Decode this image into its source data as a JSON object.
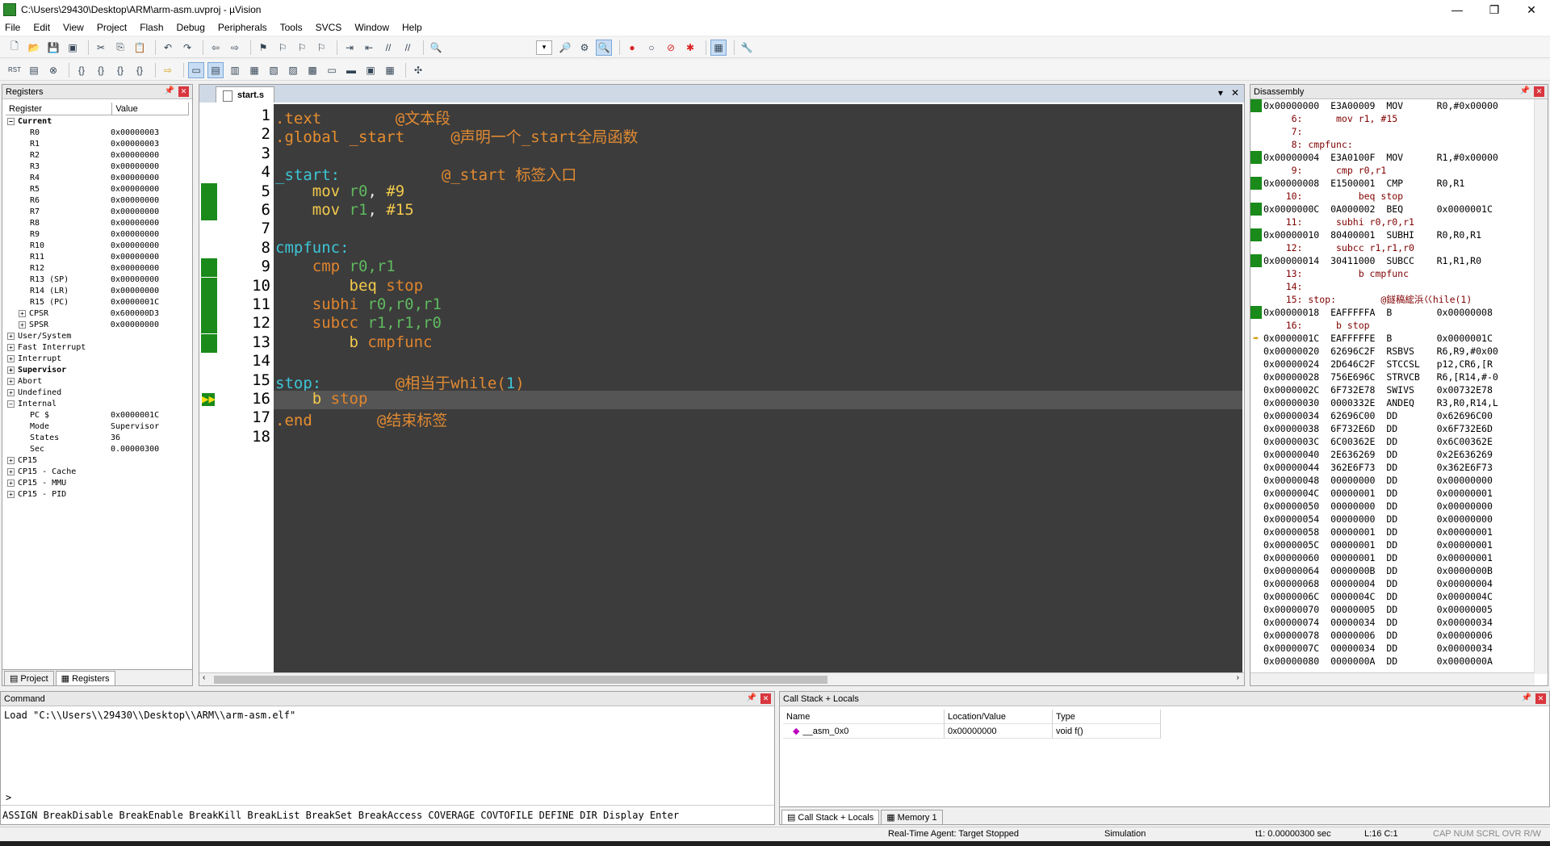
{
  "window": {
    "title": "C:\\Users\\29430\\Desktop\\ARM\\arm-asm.uvproj - µVision",
    "controls": [
      "—",
      "❐",
      "✕"
    ]
  },
  "menu": [
    "File",
    "Edit",
    "View",
    "Project",
    "Flash",
    "Debug",
    "Peripherals",
    "Tools",
    "SVCS",
    "Window",
    "Help"
  ],
  "registers": {
    "title": "Registers",
    "col_register": "Register",
    "col_value": "Value",
    "rows": [
      {
        "name": "Current",
        "value": "",
        "bold": true,
        "level": 0,
        "exp": "−"
      },
      {
        "name": "R0",
        "value": "0x00000003",
        "level": 2
      },
      {
        "name": "R1",
        "value": "0x00000003",
        "level": 2
      },
      {
        "name": "R2",
        "value": "0x00000000",
        "level": 2
      },
      {
        "name": "R3",
        "value": "0x00000000",
        "level": 2
      },
      {
        "name": "R4",
        "value": "0x00000000",
        "level": 2
      },
      {
        "name": "R5",
        "value": "0x00000000",
        "level": 2
      },
      {
        "name": "R6",
        "value": "0x00000000",
        "level": 2
      },
      {
        "name": "R7",
        "value": "0x00000000",
        "level": 2
      },
      {
        "name": "R8",
        "value": "0x00000000",
        "level": 2
      },
      {
        "name": "R9",
        "value": "0x00000000",
        "level": 2
      },
      {
        "name": "R10",
        "value": "0x00000000",
        "level": 2
      },
      {
        "name": "R11",
        "value": "0x00000000",
        "level": 2
      },
      {
        "name": "R12",
        "value": "0x00000000",
        "level": 2
      },
      {
        "name": "R13 (SP)",
        "value": "0x00000000",
        "level": 2
      },
      {
        "name": "R14 (LR)",
        "value": "0x00000000",
        "level": 2
      },
      {
        "name": "R15 (PC)",
        "value": "0x0000001C",
        "level": 2
      },
      {
        "name": "CPSR",
        "value": "0x600000D3",
        "level": 1,
        "exp": "+"
      },
      {
        "name": "SPSR",
        "value": "0x00000000",
        "level": 1,
        "exp": "+"
      },
      {
        "name": "User/System",
        "value": "",
        "level": 0,
        "exp": "+"
      },
      {
        "name": "Fast Interrupt",
        "value": "",
        "level": 0,
        "exp": "+"
      },
      {
        "name": "Interrupt",
        "value": "",
        "level": 0,
        "exp": "+"
      },
      {
        "name": "Supervisor",
        "value": "",
        "bold": true,
        "level": 0,
        "exp": "+"
      },
      {
        "name": "Abort",
        "value": "",
        "level": 0,
        "exp": "+"
      },
      {
        "name": "Undefined",
        "value": "",
        "level": 0,
        "exp": "+"
      },
      {
        "name": "Internal",
        "value": "",
        "level": 0,
        "exp": "−"
      },
      {
        "name": "PC  $",
        "value": "0x0000001C",
        "level": 2
      },
      {
        "name": "Mode",
        "value": "Supervisor",
        "level": 2
      },
      {
        "name": "States",
        "value": "36",
        "level": 2
      },
      {
        "name": "Sec",
        "value": "0.00000300",
        "level": 2
      },
      {
        "name": "CP15",
        "value": "",
        "level": 0,
        "exp": "+"
      },
      {
        "name": "CP15 - Cache",
        "value": "",
        "level": 0,
        "exp": "+"
      },
      {
        "name": "CP15 - MMU",
        "value": "",
        "level": 0,
        "exp": "+"
      },
      {
        "name": "CP15 - PID",
        "value": "",
        "level": 0,
        "exp": "+"
      }
    ],
    "tabs": [
      "Project",
      "Registers"
    ]
  },
  "editor": {
    "file_tab": "start.s",
    "lines": [
      {
        "n": "1",
        "parts": [
          [
            ".text",
            "dir"
          ],
          [
            "        ",
            ""
          ],
          [
            "@文本段",
            "cmt"
          ]
        ]
      },
      {
        "n": "2",
        "parts": [
          [
            ".global _start",
            "dir"
          ],
          [
            "     ",
            ""
          ],
          [
            "@声明一个_start全局函数",
            "cmt"
          ]
        ]
      },
      {
        "n": "3",
        "parts": []
      },
      {
        "n": "4",
        "parts": [
          [
            "_start:",
            "lbl"
          ],
          [
            "           ",
            ""
          ],
          [
            "@_start 标签入口",
            "cmt"
          ]
        ]
      },
      {
        "n": "5",
        "parts": [
          [
            "    ",
            ""
          ],
          [
            "mov",
            "op"
          ],
          [
            " ",
            ""
          ],
          [
            "r0",
            "reg"
          ],
          [
            ", ",
            ""
          ],
          [
            "#9",
            "num"
          ]
        ],
        "mark": true
      },
      {
        "n": "6",
        "parts": [
          [
            "    ",
            ""
          ],
          [
            "mov",
            "op"
          ],
          [
            " ",
            ""
          ],
          [
            "r1",
            "reg"
          ],
          [
            ", ",
            ""
          ],
          [
            "#15",
            "num"
          ]
        ],
        "mark": true
      },
      {
        "n": "7",
        "parts": []
      },
      {
        "n": "8",
        "parts": [
          [
            "cmpfunc:",
            "lbl"
          ]
        ]
      },
      {
        "n": "9",
        "parts": [
          [
            "    ",
            ""
          ],
          [
            "cmp",
            "br"
          ],
          [
            " ",
            ""
          ],
          [
            "r0,r1",
            "reg"
          ]
        ],
        "mark": true
      },
      {
        "n": "10",
        "parts": [
          [
            "        ",
            ""
          ],
          [
            "beq",
            "op"
          ],
          [
            " ",
            ""
          ],
          [
            "stop",
            "br"
          ]
        ],
        "mark": true
      },
      {
        "n": "11",
        "parts": [
          [
            "    ",
            ""
          ],
          [
            "subhi",
            "br"
          ],
          [
            " ",
            ""
          ],
          [
            "r0,r0,r1",
            "reg"
          ]
        ],
        "mark": true
      },
      {
        "n": "12",
        "parts": [
          [
            "    ",
            ""
          ],
          [
            "subcc",
            "br"
          ],
          [
            " ",
            ""
          ],
          [
            "r1,r1,r0",
            "reg"
          ]
        ],
        "mark": true
      },
      {
        "n": "13",
        "parts": [
          [
            "        ",
            ""
          ],
          [
            "b",
            "op"
          ],
          [
            " ",
            ""
          ],
          [
            "cmpfunc",
            "br"
          ]
        ],
        "mark": true
      },
      {
        "n": "14",
        "parts": []
      },
      {
        "n": "15",
        "parts": [
          [
            "stop:",
            "lbl"
          ],
          [
            "        ",
            ""
          ],
          [
            "@相当于while(",
            "cmt"
          ],
          [
            "1",
            "lbl"
          ],
          [
            ")",
            "cmt"
          ]
        ]
      },
      {
        "n": "16",
        "parts": [
          [
            "    ",
            ""
          ],
          [
            "b",
            "op"
          ],
          [
            " ",
            ""
          ],
          [
            "stop",
            "br"
          ]
        ],
        "current": true
      },
      {
        "n": "17",
        "parts": [
          [
            ".end",
            "dir"
          ],
          [
            "       ",
            ""
          ],
          [
            "@结束标签",
            "cmt"
          ]
        ]
      },
      {
        "n": "18",
        "parts": []
      }
    ]
  },
  "disassembly": {
    "title": "Disassembly",
    "rows": [
      {
        "t": "0x00000000  E3A00009  MOV      R0,#0x00000",
        "m": "g"
      },
      {
        "t": "     6:      mov r1, #15",
        "src": true
      },
      {
        "t": "     7: ",
        "src": true
      },
      {
        "t": "     8: cmpfunc: ",
        "src": true
      },
      {
        "t": "0x00000004  E3A0100F  MOV      R1,#0x00000",
        "m": "g"
      },
      {
        "t": "     9:      cmp r0,r1",
        "src": true
      },
      {
        "t": "0x00000008  E1500001  CMP      R0,R1",
        "m": "g"
      },
      {
        "t": "    10:          beq stop",
        "src": true
      },
      {
        "t": "0x0000000C  0A000002  BEQ      0x0000001C",
        "m": "g"
      },
      {
        "t": "    11:      subhi r0,r0,r1",
        "src": true
      },
      {
        "t": "0x00000010  80400001  SUBHI    R0,R0,R1",
        "m": "g"
      },
      {
        "t": "    12:      subcc r1,r1,r0",
        "src": true
      },
      {
        "t": "0x00000014  30411000  SUBCC    R1,R1,R0",
        "m": "g"
      },
      {
        "t": "    13:          b cmpfunc",
        "src": true
      },
      {
        "t": "    14: ",
        "src": true
      },
      {
        "t": "    15: stop:        @鐩稿綋浜巜hile(1)",
        "src": true
      },
      {
        "t": "0x00000018  EAFFFFFA  B        0x00000008",
        "m": "g"
      },
      {
        "t": "    16:      b stop",
        "src": true
      },
      {
        "t": "0x0000001C  EAFFFFFE  B        0x0000001C",
        "m": "y"
      },
      {
        "t": "0x00000020  62696C2F  RSBVS    R6,R9,#0x00"
      },
      {
        "t": "0x00000024  2D646C2F  STCCSL   p12,CR6,[R"
      },
      {
        "t": "0x00000028  756E696C  STRVCB   R6,[R14,#-0"
      },
      {
        "t": "0x0000002C  6F732E78  SWIVS    0x00732E78"
      },
      {
        "t": "0x00000030  0000332E  ANDEQ    R3,R0,R14,L"
      },
      {
        "t": "0x00000034  62696C00  DD       0x62696C00"
      },
      {
        "t": "0x00000038  6F732E6D  DD       0x6F732E6D"
      },
      {
        "t": "0x0000003C  6C00362E  DD       0x6C00362E"
      },
      {
        "t": "0x00000040  2E636269  DD       0x2E636269"
      },
      {
        "t": "0x00000044  362E6F73  DD       0x362E6F73"
      },
      {
        "t": "0x00000048  00000000  DD       0x00000000"
      },
      {
        "t": "0x0000004C  00000001  DD       0x00000001"
      },
      {
        "t": "0x00000050  00000000  DD       0x00000000"
      },
      {
        "t": "0x00000054  00000000  DD       0x00000000"
      },
      {
        "t": "0x00000058  00000001  DD       0x00000001"
      },
      {
        "t": "0x0000005C  00000001  DD       0x00000001"
      },
      {
        "t": "0x00000060  00000001  DD       0x00000001"
      },
      {
        "t": "0x00000064  0000000B  DD       0x0000000B"
      },
      {
        "t": "0x00000068  00000004  DD       0x00000004"
      },
      {
        "t": "0x0000006C  0000004C  DD       0x0000004C"
      },
      {
        "t": "0x00000070  00000005  DD       0x00000005"
      },
      {
        "t": "0x00000074  00000034  DD       0x00000034"
      },
      {
        "t": "0x00000078  00000006  DD       0x00000006"
      },
      {
        "t": "0x0000007C  00000034  DD       0x00000034"
      },
      {
        "t": "0x00000080  0000000A  DD       0x0000000A"
      }
    ]
  },
  "command": {
    "title": "Command",
    "output": "Load \"C:\\\\Users\\\\29430\\\\Desktop\\\\ARM\\\\arm-asm.elf\"",
    "prompt": ">",
    "commands": "ASSIGN BreakDisable BreakEnable BreakKill BreakList BreakSet BreakAccess COVERAGE COVTOFILE DEFINE DIR Display Enter"
  },
  "callstack": {
    "title": "Call Stack + Locals",
    "col_name": "Name",
    "col_loc": "Location/Value",
    "col_type": "Type",
    "row_name": "__asm_0x0",
    "row_loc": "0x00000000",
    "row_type": "void f()",
    "tabs": [
      "Call Stack + Locals",
      "Memory 1"
    ]
  },
  "status": {
    "agent": "Real-Time Agent: Target Stopped",
    "mode": "Simulation",
    "time": "t1: 0.00000300 sec",
    "pos": "L:16 C:1",
    "flags": "CAP  NUM  SCRL  OVR  R/W"
  }
}
